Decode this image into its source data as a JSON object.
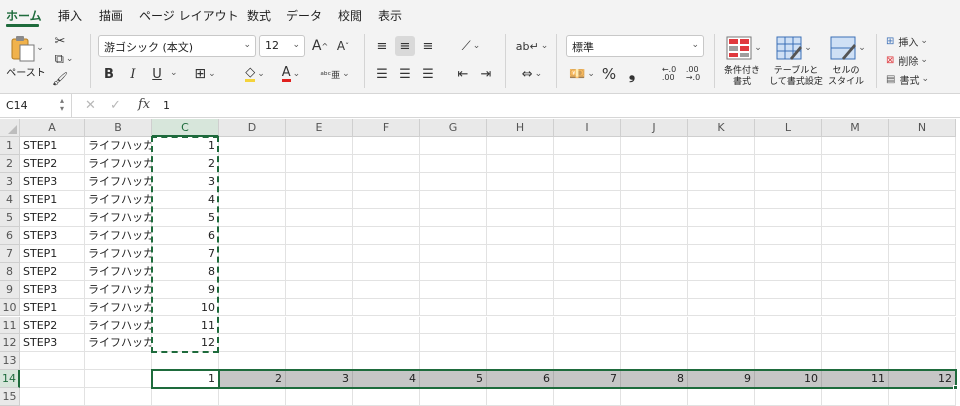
{
  "ribbon_tabs": [
    "ホーム",
    "挿入",
    "描画",
    "ページ レイアウト",
    "数式",
    "データ",
    "校閲",
    "表示"
  ],
  "clipboard": {
    "paste_label": "ペースト"
  },
  "font": {
    "name": "游ゴシック (本文)",
    "size": "12"
  },
  "format": {
    "bold": "B",
    "italic": "I",
    "underline": "U",
    "font_color_icon": "A",
    "highlight_icon": "A"
  },
  "number": {
    "format": "標準",
    "percent": "%",
    "comma": "❟"
  },
  "styles": {
    "conditional": [
      "条件付き",
      "書式"
    ],
    "table": [
      "テーブルと",
      "して書式設定"
    ],
    "cell": [
      "セルの",
      "スタイル"
    ]
  },
  "cells_group": {
    "insert": "挿入",
    "delete": "削除",
    "format": "書式"
  },
  "formula_bar": {
    "name_box": "C14",
    "fx": "fx",
    "value": "1"
  },
  "columns": [
    "A",
    "B",
    "C",
    "D",
    "E",
    "F",
    "G",
    "H",
    "I",
    "J",
    "K",
    "L",
    "M",
    "N"
  ],
  "row_numbers": [
    "1",
    "2",
    "3",
    "4",
    "5",
    "6",
    "7",
    "8",
    "9",
    "10",
    "11",
    "12",
    "13",
    "14",
    "15"
  ],
  "rows": [
    [
      "STEP1",
      "ライフハッカ",
      "1"
    ],
    [
      "STEP2",
      "ライフハッカ",
      "2"
    ],
    [
      "STEP3",
      "ライフハッカ",
      "3"
    ],
    [
      "STEP1",
      "ライフハッカ",
      "4"
    ],
    [
      "STEP2",
      "ライフハッカ",
      "5"
    ],
    [
      "STEP3",
      "ライフハッカ",
      "6"
    ],
    [
      "STEP1",
      "ライフハッカ",
      "7"
    ],
    [
      "STEP2",
      "ライフハッカ",
      "8"
    ],
    [
      "STEP3",
      "ライフハッカ",
      "9"
    ],
    [
      "STEP1",
      "ライフハッカ",
      "10"
    ],
    [
      "STEP2",
      "ライフハッカ",
      "11"
    ],
    [
      "STEP3",
      "ライフハッカ",
      "12"
    ]
  ],
  "row14_values": [
    "1",
    "2",
    "3",
    "4",
    "5",
    "6",
    "7",
    "8",
    "9",
    "10",
    "11",
    "12"
  ],
  "colors": {
    "accent": "#1e6b3c",
    "highlight": "#c6c6c6"
  }
}
